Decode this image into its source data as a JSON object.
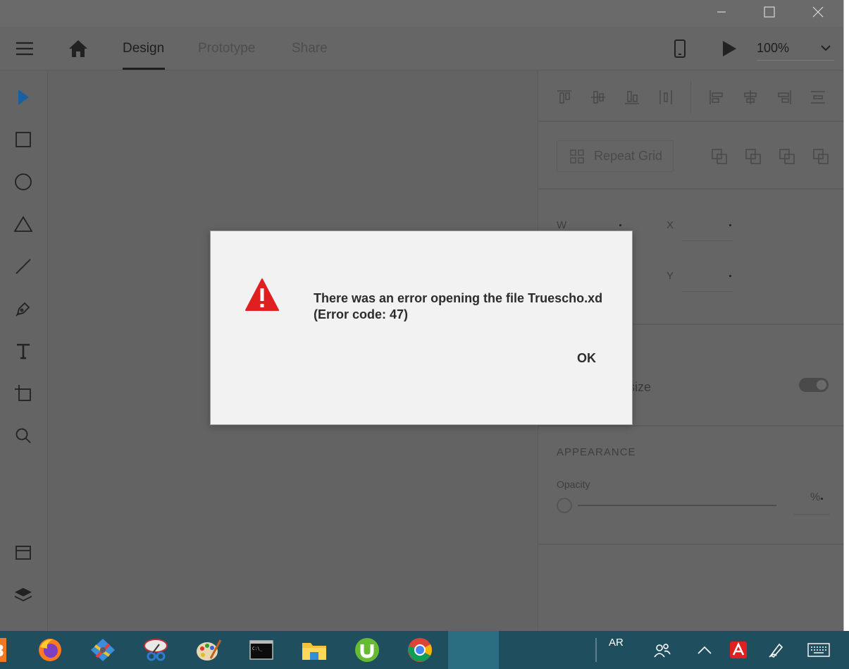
{
  "window": {
    "controls": [
      "minimize-icon",
      "maximize-icon",
      "close-icon"
    ]
  },
  "header": {
    "tabs": [
      {
        "label": "Design",
        "active": true
      },
      {
        "label": "Prototype",
        "active": false
      },
      {
        "label": "Share",
        "active": false
      }
    ],
    "zoom": "100%"
  },
  "toolbar": {
    "tools": [
      "select",
      "rectangle",
      "ellipse",
      "polygon",
      "line",
      "pen",
      "text",
      "artboard",
      "zoom"
    ],
    "bottom": [
      "assets",
      "layers"
    ]
  },
  "panel": {
    "repeat_grid_label": "Repeat Grid",
    "w_label": "W",
    "x_label": "X",
    "y_label": "Y",
    "resize_label_partial": "esize",
    "appearance_title": "APPEARANCE",
    "opacity_label": "Opacity",
    "opacity_unit": "%"
  },
  "dialog": {
    "message_line1": "There was an error opening the file Truescho.xd",
    "message_line2": "(Error code: 47)",
    "ok_label": "OK"
  },
  "taskbar": {
    "lang": "AR",
    "apps": [
      "app-3-icon",
      "firefox-icon",
      "gimp-icon",
      "snipping-icon",
      "paint-icon",
      "terminal-icon",
      "file-explorer-icon",
      "utorrent-icon",
      "chrome-icon"
    ],
    "colors": {
      "bar": "#1f4e5e",
      "active": "#2b6e82",
      "accent_red": "#e02020"
    }
  }
}
